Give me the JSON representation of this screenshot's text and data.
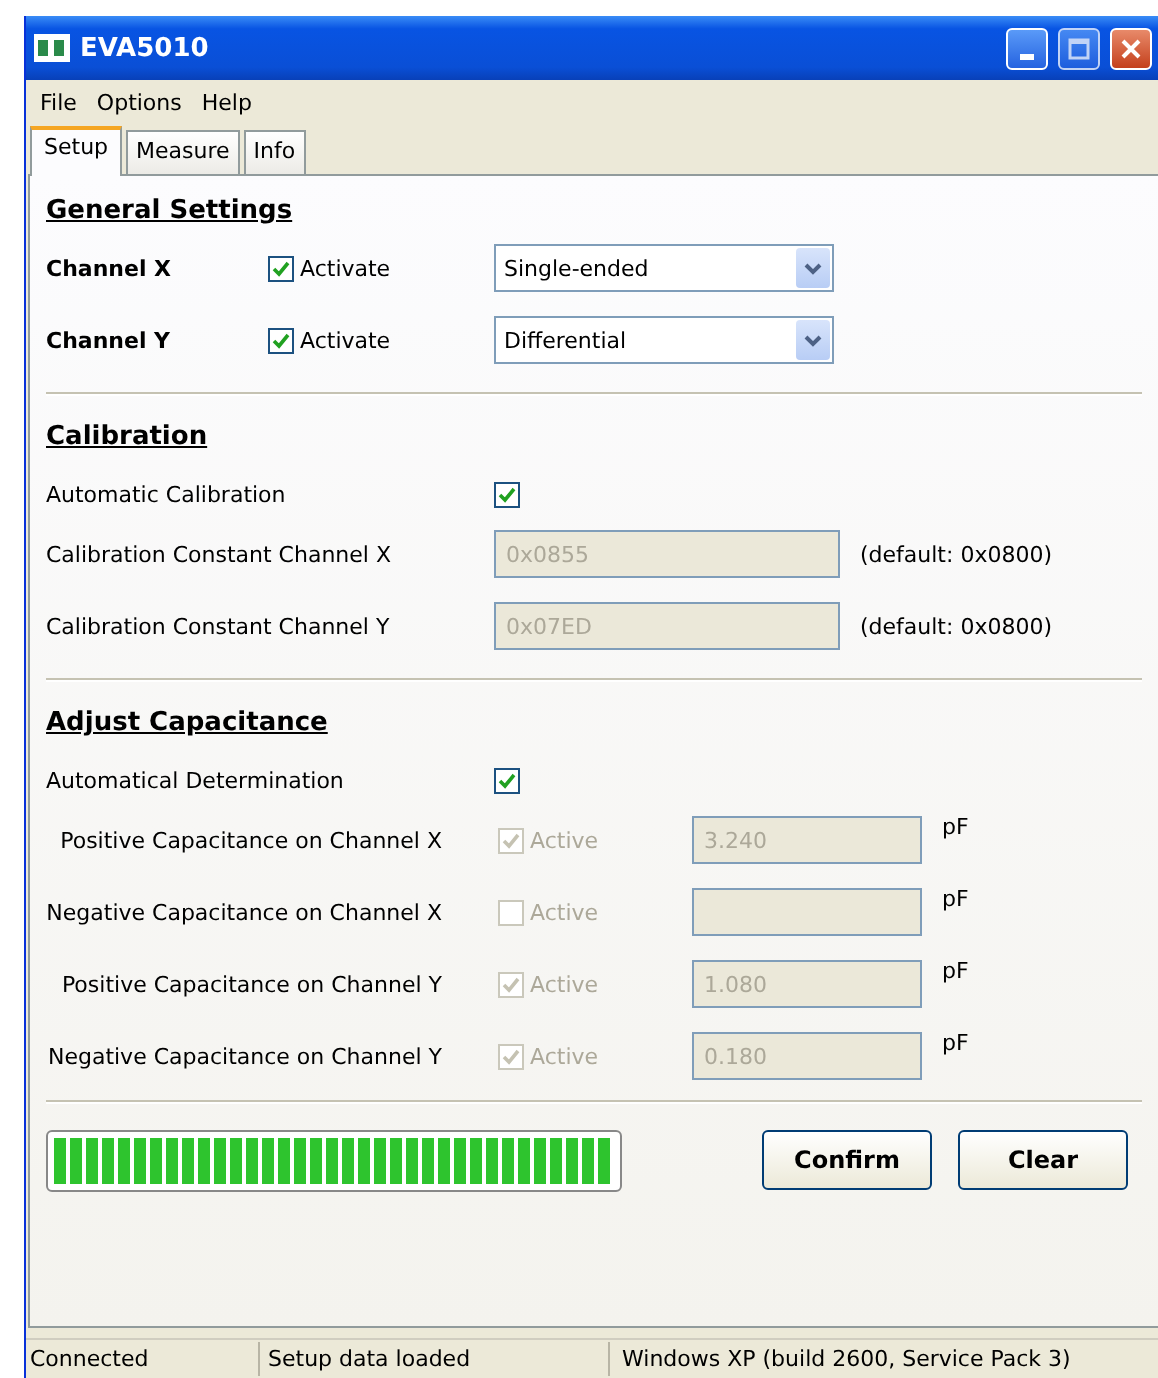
{
  "window": {
    "title": "EVA5010"
  },
  "menu": [
    "File",
    "Options",
    "Help"
  ],
  "tabs": [
    {
      "label": "Setup",
      "selected": true
    },
    {
      "label": "Measure",
      "selected": false
    },
    {
      "label": "Info",
      "selected": false
    }
  ],
  "general_settings": {
    "title": "General Settings",
    "channels": [
      {
        "label": "Channel X",
        "activate": {
          "label": "Activate",
          "checked": true
        },
        "mode": "Single-ended"
      },
      {
        "label": "Channel Y",
        "activate": {
          "label": "Activate",
          "checked": true
        },
        "mode": "Differential"
      }
    ]
  },
  "calibration": {
    "title": "Calibration",
    "automatic": {
      "label": "Automatic Calibration",
      "checked": true
    },
    "constants": [
      {
        "label": "Calibration Constant Channel X",
        "value": "0x0855",
        "disabled": true,
        "hint": "(default: 0x0800)"
      },
      {
        "label": "Calibration Constant Channel Y",
        "value": "0x07ED",
        "disabled": true,
        "hint": "(default: 0x0800)"
      }
    ]
  },
  "adjust_capacitance": {
    "title": "Adjust Capacitance",
    "automatic": {
      "label": "Automatical Determination",
      "checked": true
    },
    "rows": [
      {
        "label": "Positive Capacitance on Channel X",
        "active": {
          "label": "Active",
          "checked": true,
          "disabled": true
        },
        "value": "3.240",
        "disabled": true,
        "unit": "pF"
      },
      {
        "label": "Negative Capacitance on Channel X",
        "active": {
          "label": "Active",
          "checked": false,
          "disabled": true
        },
        "disabled": true,
        "unit": "pF"
      },
      {
        "label": "Positive Capacitance on Channel Y",
        "active": {
          "label": "Active",
          "checked": true,
          "disabled": true
        },
        "value": "1.080",
        "disabled": true,
        "unit": "pF"
      },
      {
        "label": "Negative Capacitance on Channel Y",
        "active": {
          "label": "Active",
          "checked": true,
          "disabled": true
        },
        "value": "0.180",
        "disabled": true,
        "unit": "pF"
      }
    ]
  },
  "progress": {
    "level": 1
  },
  "buttons": [
    "Confirm",
    "Clear"
  ],
  "status_bar": [
    "Connected",
    "Setup data loaded",
    "Windows XP (build 2600, Service Pack 3)"
  ]
}
